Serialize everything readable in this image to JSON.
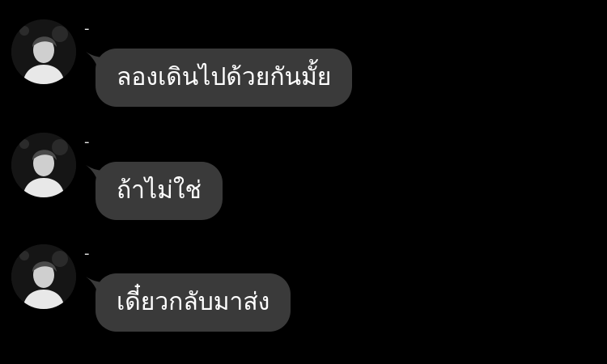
{
  "conversation": {
    "messages": [
      {
        "sender": "-",
        "text": "ลองเดินไปด้วยกันมั้ย",
        "avatar_icon": "profile-photo"
      },
      {
        "sender": "-",
        "text": "ถ้าไม่ใช่",
        "avatar_icon": "profile-photo"
      },
      {
        "sender": "-",
        "text": "เดี๋ยวกลับมาส่ง",
        "avatar_icon": "profile-photo"
      }
    ]
  },
  "colors": {
    "background": "#000000",
    "bubble": "#3a3a3a",
    "text": "#ffffff"
  }
}
